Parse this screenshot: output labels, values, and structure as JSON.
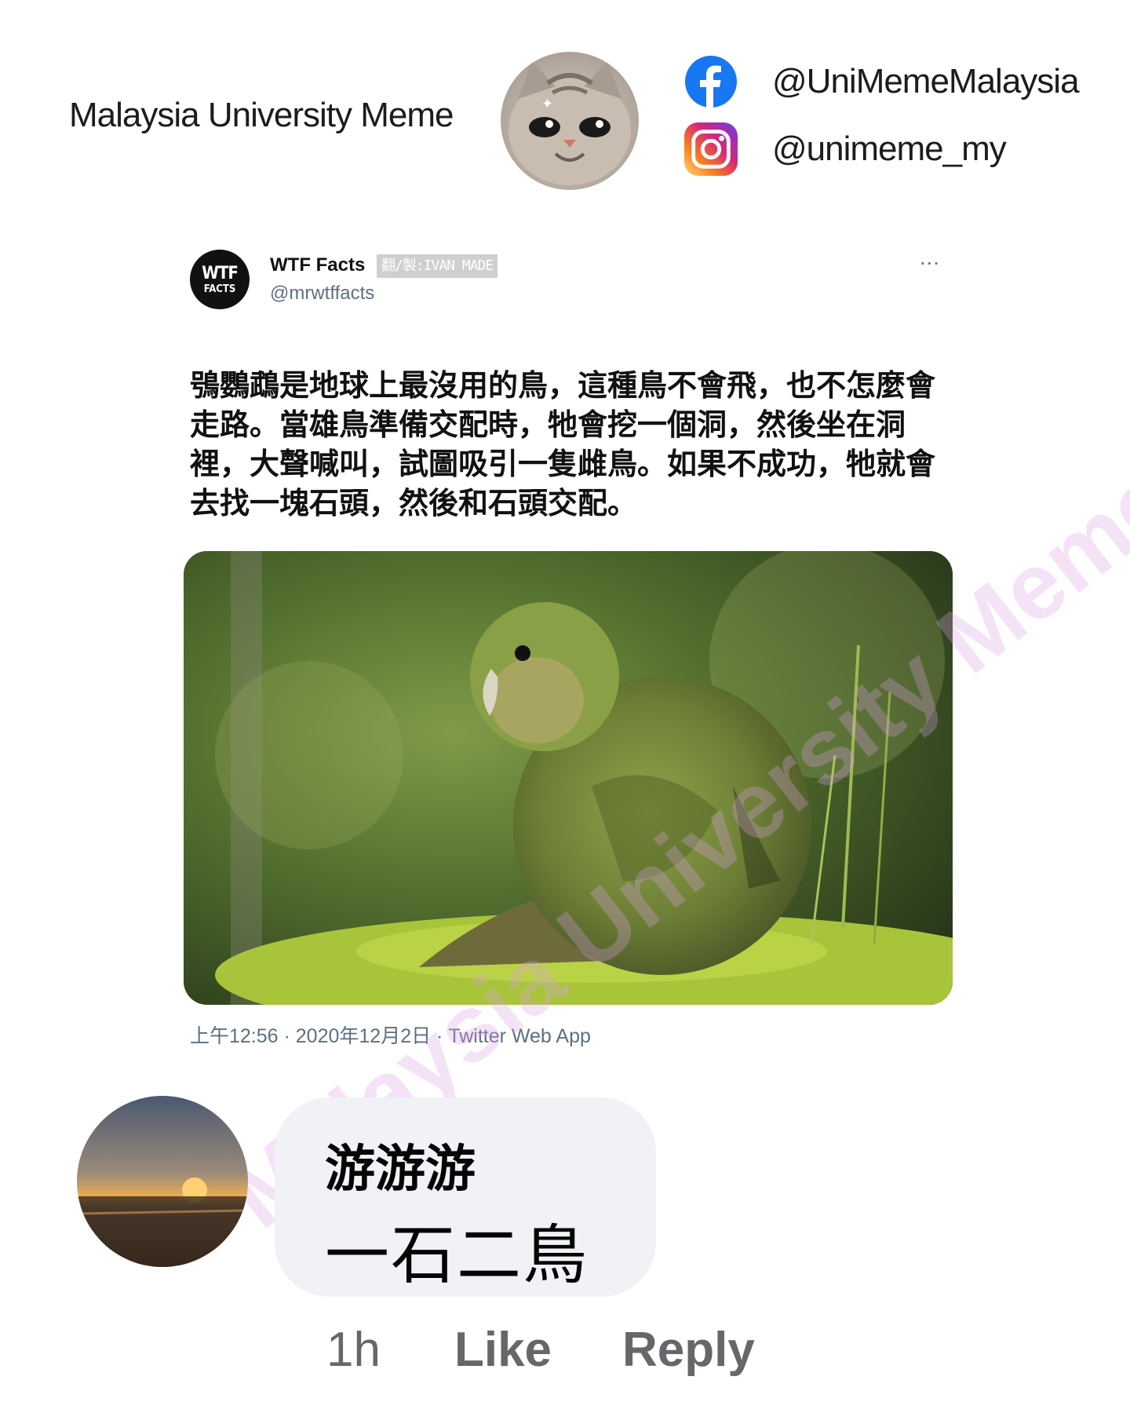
{
  "header": {
    "brand_title": "Malaysia University Meme",
    "facebook": {
      "icon": "facebook-icon",
      "handle": "@UniMemeMalaysia",
      "color": "#1877f2"
    },
    "instagram": {
      "icon": "instagram-icon",
      "handle": "@unimeme_my"
    }
  },
  "tweet": {
    "avatar_line1": "WTF",
    "avatar_line2": "FACTS",
    "display_name": "WTF Facts",
    "translator_tag": "翻/製:IVAN MADE",
    "handle": "@mrwtffacts",
    "more": "···",
    "text": "鴞鸚鵡是地球上最沒用的鳥，這種鳥不會飛，也不怎麼會走路。當雄鳥準備交配時，牠會挖一個洞，然後坐在洞裡，大聲喊叫，試圖吸引一隻雌鳥。如果不成功，牠就會去找一塊石頭，然後和石頭交配。",
    "meta": "上午12:56 · 2020年12月2日 · Twitter Web App"
  },
  "comment": {
    "author": "游游游",
    "text": "一石二鳥",
    "time": "1h",
    "like_label": "Like",
    "reply_label": "Reply"
  },
  "watermark": "Malaysia University Meme",
  "colors": {
    "bubble": "#f0f2f5",
    "secondary_text": "#65676b",
    "twitter_gray": "#5b7083"
  }
}
